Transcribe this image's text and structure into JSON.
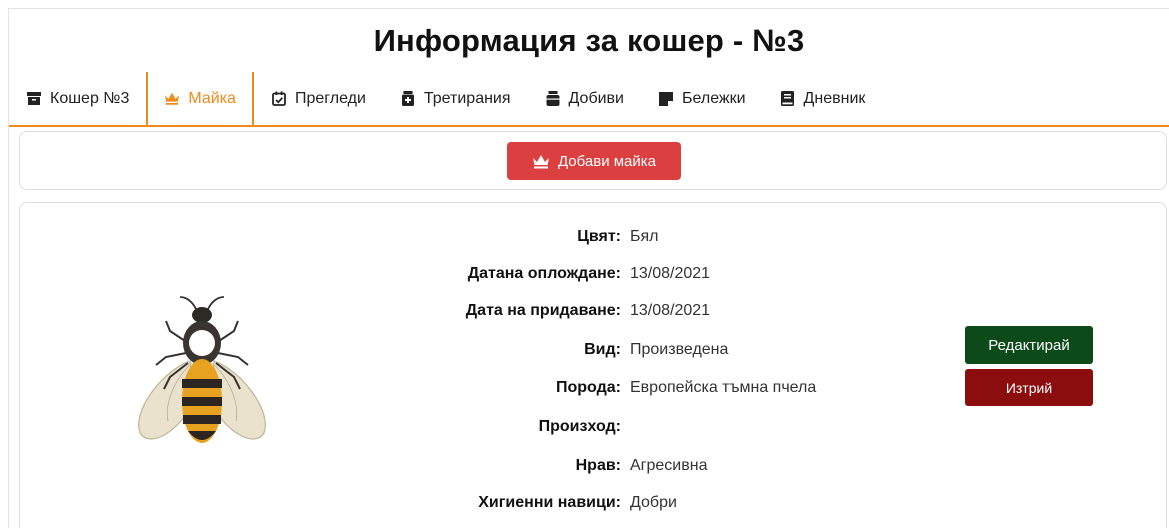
{
  "page": {
    "title": "Информация за кошер - №3"
  },
  "tabs": [
    {
      "label": "Кошер №3",
      "icon": "box-archive-icon",
      "active": false
    },
    {
      "label": "Майка",
      "icon": "crown-icon",
      "active": true
    },
    {
      "label": "Прегледи",
      "icon": "calendar-check-icon",
      "active": false
    },
    {
      "label": "Третирания",
      "icon": "medicine-bottle-icon",
      "active": false
    },
    {
      "label": "Добиви",
      "icon": "jar-icon",
      "active": false
    },
    {
      "label": "Бележки",
      "icon": "sticky-note-icon",
      "active": false
    },
    {
      "label": "Дневник",
      "icon": "book-icon",
      "active": false
    }
  ],
  "actions": {
    "add_queen_label": "Добави майка"
  },
  "queen": {
    "image": "queen-bee-icon",
    "fields": [
      {
        "label": "Цвят:",
        "value": "Бял"
      },
      {
        "label": "Датана оплождане:",
        "value": "13/08/2021"
      },
      {
        "label": "Дата на придаване:",
        "value": "13/08/2021"
      },
      {
        "label": "Вид:",
        "value": "Произведена"
      },
      {
        "label": "Порода:",
        "value": "Европейска тъмна пчела"
      },
      {
        "label": "Произход:",
        "value": ""
      },
      {
        "label": "Нрав:",
        "value": "Агресивна"
      },
      {
        "label": "Хигиенни навици:",
        "value": "Добри"
      }
    ],
    "edit_label": "Редактирай",
    "delete_label": "Изтрий"
  },
  "colors": {
    "accent": "#f08a1c",
    "add_button": "#dc3f3f",
    "edit_button": "#0d4a1a",
    "delete_button": "#8b0d0d"
  }
}
